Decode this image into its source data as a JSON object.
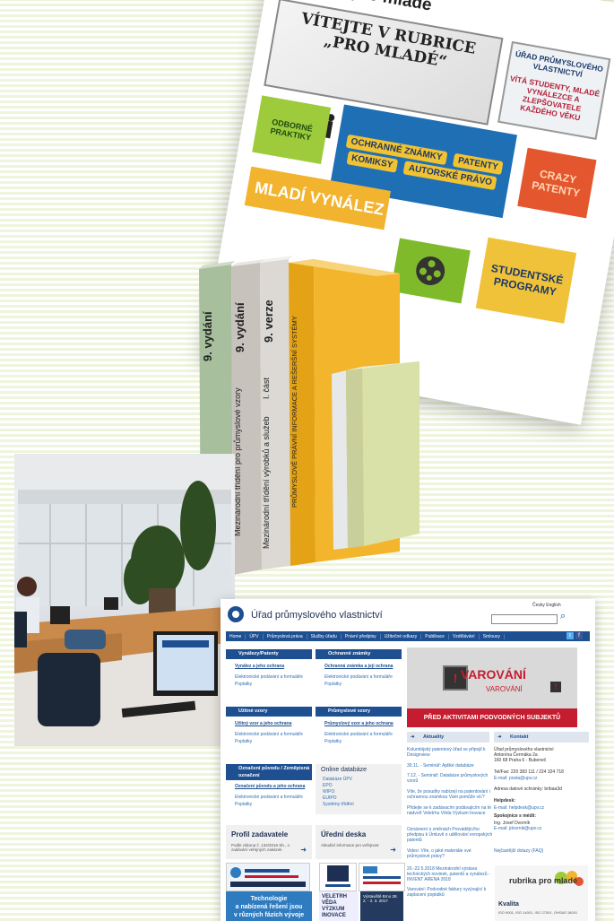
{
  "youth_page": {
    "title": "Rubrika pro mladé",
    "banner": "VÍTEJTE V RUBRICE „PRO MLADÉ“",
    "side_box": "ÚŘAD PRŮMYSLOVÉHO VLASTNICTVÍ",
    "side_tagline": "VÍTÁ STUDENTY, MLADÉ VYNÁLEZCE A ZLEPŠOVATELE KAŽDÉHO VĚKU",
    "tile_schools": "ODBORNÉ PRAKTIKY",
    "tile_main_1": "OCHRANNÉ ZNÁMKY",
    "tile_main_2": "PATENTY",
    "tile_main_3": "AUTORSKÉ PRÁVO",
    "tile_comics": "KOMIKSY",
    "tile_crazy": "CRAZY PATENTY",
    "tile_inventors": "MLADÍ VYNÁLEZ",
    "tile_student": "STUDENTSKÉ PROGRAMY"
  },
  "books": {
    "b1": "9. vydání",
    "b2": "9. vydání",
    "b2_sub": "Mezinárodní třídění pro průmyslové vzory",
    "b3": "9. verze",
    "b3_sub": "Mezinárodní třídění výrobků a služeb",
    "b3_part": "I. část",
    "b4": "PRŮMYSLOVĚ PRÁVNÍ INFORMACE A REŠERŠNÍ SYSTÉMY"
  },
  "site": {
    "title": "Úřad průmyslového vlastnictví",
    "lang": "Česky   English",
    "nav": [
      "Home",
      "ÚPV",
      "Průmyslová práva",
      "Služby úřadu",
      "Právní předpisy",
      "Užitečné odkazy",
      "Publikace",
      "Vzdělávání",
      "Smlouvy"
    ],
    "box1_head": "Vynálezy/Patenty",
    "box1_l1": "Vynález a jeho ochrana",
    "box1_l2": "Elektronické podávání a formuláře",
    "box1_l3": "Poplatky",
    "box2_head": "Ochranné známky",
    "box2_l1": "Ochranná známka a její ochrana",
    "box2_l2": "Elektronické podávání a formuláře",
    "box2_l3": "Poplatky",
    "box3_head": "Užitné vzory",
    "box3_l1": "Užitný vzor a jeho ochrana",
    "box3_l2": "Elektronické podávání a formuláře",
    "box3_l3": "Poplatky",
    "box4_head": "Průmyslové vzory",
    "box4_l1": "Průmyslový vzor a jeho ochrana",
    "box4_l2": "Elektronické podávání a formuláře",
    "box4_l3": "Poplatky",
    "box5_head": "Označení původu / Zeměpisná označení",
    "box5_l1": "Označení původu a jeho ochrana",
    "box5_l2": "Elektronické podávání a formuláře",
    "box5_l3": "Poplatky",
    "db_title": "Online databáze",
    "db_items": [
      "Databáze ÚPV",
      "EPO",
      "WIPO",
      "EUIPO",
      "Systémy třídění"
    ],
    "warning_big": "VAROVÁNÍ",
    "warning_small": "VAROVÁNÍ",
    "warning_banner": "PŘED AKTIVITAMI PODVODNÝCH SUBJEKTŮ",
    "news_head": "Aktuality",
    "news": [
      "Kolumbijský patentový úřad se připojil k Designview",
      "30.11. - Seminář: Apliké databáze",
      "7.12. - Seminář: Databáze průmyslových vzorů",
      "Víte, že posudky nabízejí na patentování i ochrannou známkou Vám pomůže víc?",
      "Přidejte se k zadávacím podávajícím na té nádvoří Veletrhu Věda Výzkum Inovace",
      "Oznámení o změnách Provádějícího předpisu k Úmluvě o udělování evropských patentů",
      "Video: Víte, o jaké materiále své průmyslové právy?",
      "20.-22.5.2018 Mezinárodní výstava technických novinek, patentů a vynálezů - INVENT ARENA 2018",
      "Varování: Podvodné faktury vyzývající k zaplacení poplatků"
    ],
    "contact_head": "Kontakt",
    "contact": [
      "Úřad průmyslového vlastnictví",
      "Antonína Čermáka 2a",
      "160 68 Praha 6 - Bubeneč",
      "",
      "Tel/Fax: 220 383 111 / 224 324 718",
      "E-mail: posta@upv.cz",
      "",
      "Adresa datové schránky: bribaa3d",
      "",
      "Helpdesk:",
      "E-mail: helpdesk@upv.cz",
      "Spokojnice s médii:",
      "Ing. Josef Dvorník",
      "E-mail: jdvornik@upv.cz",
      "",
      "Nejčastější dotazy (FAQ)"
    ],
    "profile_title": "Profil zadavatele",
    "profile_text": "Podle zákona č. 134/2016 Sb., o zadávání veřejných zakázek",
    "board_title": "Úřední deska",
    "board_text": "Aktuální informace pro veřejnost",
    "tech_line1": "Technologie",
    "tech_line2": "a nabízená řešení jsou",
    "tech_line3": "v různých fázích vývoje",
    "veletrh": "VELETRH VĚDA VÝZKUM INOVACE",
    "vystava": "Výstaviště Brno 28. 2. - 2. 3. 2017",
    "youth_mini": "rubrika pro mladé",
    "kvalita": "Kvalita",
    "kvalita_sub": "ISO 9001, ISO 14001, ISO 27001, OHSAS 18001"
  },
  "colors": {
    "brand": "#1d4f91",
    "warning": "#c51d2f"
  }
}
